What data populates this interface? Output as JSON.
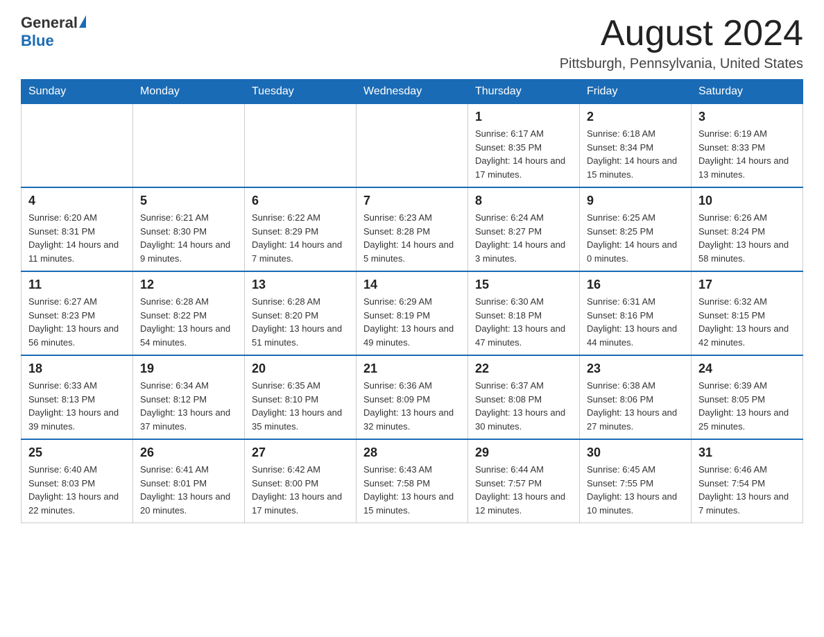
{
  "logo": {
    "general": "General",
    "blue": "Blue"
  },
  "title": {
    "month": "August 2024",
    "location": "Pittsburgh, Pennsylvania, United States"
  },
  "days_of_week": [
    "Sunday",
    "Monday",
    "Tuesday",
    "Wednesday",
    "Thursday",
    "Friday",
    "Saturday"
  ],
  "weeks": [
    [
      {
        "day": "",
        "info": ""
      },
      {
        "day": "",
        "info": ""
      },
      {
        "day": "",
        "info": ""
      },
      {
        "day": "",
        "info": ""
      },
      {
        "day": "1",
        "info": "Sunrise: 6:17 AM\nSunset: 8:35 PM\nDaylight: 14 hours and 17 minutes."
      },
      {
        "day": "2",
        "info": "Sunrise: 6:18 AM\nSunset: 8:34 PM\nDaylight: 14 hours and 15 minutes."
      },
      {
        "day": "3",
        "info": "Sunrise: 6:19 AM\nSunset: 8:33 PM\nDaylight: 14 hours and 13 minutes."
      }
    ],
    [
      {
        "day": "4",
        "info": "Sunrise: 6:20 AM\nSunset: 8:31 PM\nDaylight: 14 hours and 11 minutes."
      },
      {
        "day": "5",
        "info": "Sunrise: 6:21 AM\nSunset: 8:30 PM\nDaylight: 14 hours and 9 minutes."
      },
      {
        "day": "6",
        "info": "Sunrise: 6:22 AM\nSunset: 8:29 PM\nDaylight: 14 hours and 7 minutes."
      },
      {
        "day": "7",
        "info": "Sunrise: 6:23 AM\nSunset: 8:28 PM\nDaylight: 14 hours and 5 minutes."
      },
      {
        "day": "8",
        "info": "Sunrise: 6:24 AM\nSunset: 8:27 PM\nDaylight: 14 hours and 3 minutes."
      },
      {
        "day": "9",
        "info": "Sunrise: 6:25 AM\nSunset: 8:25 PM\nDaylight: 14 hours and 0 minutes."
      },
      {
        "day": "10",
        "info": "Sunrise: 6:26 AM\nSunset: 8:24 PM\nDaylight: 13 hours and 58 minutes."
      }
    ],
    [
      {
        "day": "11",
        "info": "Sunrise: 6:27 AM\nSunset: 8:23 PM\nDaylight: 13 hours and 56 minutes."
      },
      {
        "day": "12",
        "info": "Sunrise: 6:28 AM\nSunset: 8:22 PM\nDaylight: 13 hours and 54 minutes."
      },
      {
        "day": "13",
        "info": "Sunrise: 6:28 AM\nSunset: 8:20 PM\nDaylight: 13 hours and 51 minutes."
      },
      {
        "day": "14",
        "info": "Sunrise: 6:29 AM\nSunset: 8:19 PM\nDaylight: 13 hours and 49 minutes."
      },
      {
        "day": "15",
        "info": "Sunrise: 6:30 AM\nSunset: 8:18 PM\nDaylight: 13 hours and 47 minutes."
      },
      {
        "day": "16",
        "info": "Sunrise: 6:31 AM\nSunset: 8:16 PM\nDaylight: 13 hours and 44 minutes."
      },
      {
        "day": "17",
        "info": "Sunrise: 6:32 AM\nSunset: 8:15 PM\nDaylight: 13 hours and 42 minutes."
      }
    ],
    [
      {
        "day": "18",
        "info": "Sunrise: 6:33 AM\nSunset: 8:13 PM\nDaylight: 13 hours and 39 minutes."
      },
      {
        "day": "19",
        "info": "Sunrise: 6:34 AM\nSunset: 8:12 PM\nDaylight: 13 hours and 37 minutes."
      },
      {
        "day": "20",
        "info": "Sunrise: 6:35 AM\nSunset: 8:10 PM\nDaylight: 13 hours and 35 minutes."
      },
      {
        "day": "21",
        "info": "Sunrise: 6:36 AM\nSunset: 8:09 PM\nDaylight: 13 hours and 32 minutes."
      },
      {
        "day": "22",
        "info": "Sunrise: 6:37 AM\nSunset: 8:08 PM\nDaylight: 13 hours and 30 minutes."
      },
      {
        "day": "23",
        "info": "Sunrise: 6:38 AM\nSunset: 8:06 PM\nDaylight: 13 hours and 27 minutes."
      },
      {
        "day": "24",
        "info": "Sunrise: 6:39 AM\nSunset: 8:05 PM\nDaylight: 13 hours and 25 minutes."
      }
    ],
    [
      {
        "day": "25",
        "info": "Sunrise: 6:40 AM\nSunset: 8:03 PM\nDaylight: 13 hours and 22 minutes."
      },
      {
        "day": "26",
        "info": "Sunrise: 6:41 AM\nSunset: 8:01 PM\nDaylight: 13 hours and 20 minutes."
      },
      {
        "day": "27",
        "info": "Sunrise: 6:42 AM\nSunset: 8:00 PM\nDaylight: 13 hours and 17 minutes."
      },
      {
        "day": "28",
        "info": "Sunrise: 6:43 AM\nSunset: 7:58 PM\nDaylight: 13 hours and 15 minutes."
      },
      {
        "day": "29",
        "info": "Sunrise: 6:44 AM\nSunset: 7:57 PM\nDaylight: 13 hours and 12 minutes."
      },
      {
        "day": "30",
        "info": "Sunrise: 6:45 AM\nSunset: 7:55 PM\nDaylight: 13 hours and 10 minutes."
      },
      {
        "day": "31",
        "info": "Sunrise: 6:46 AM\nSunset: 7:54 PM\nDaylight: 13 hours and 7 minutes."
      }
    ]
  ]
}
